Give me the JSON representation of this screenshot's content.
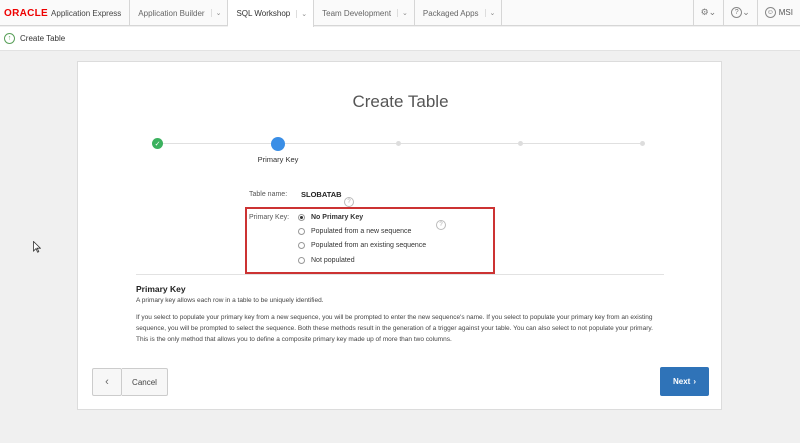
{
  "topnav": {
    "brand_oracle": "ORACLE",
    "brand_product": "Application Express",
    "tabs": [
      {
        "label": "Application Builder",
        "active": false
      },
      {
        "label": "SQL Workshop",
        "active": true
      },
      {
        "label": "Team Development",
        "active": false
      },
      {
        "label": "Packaged Apps",
        "active": false
      }
    ],
    "user": "MSI"
  },
  "breadcrumb": {
    "title": "Create Table"
  },
  "wizard": {
    "title": "Create Table",
    "current_step_label": "Primary Key",
    "table_name_label": "Table name:",
    "table_name_value": "SLOBATAB",
    "primary_key_label": "Primary Key:",
    "options": [
      {
        "label": "No Primary Key",
        "selected": true
      },
      {
        "label": "Populated from a new sequence",
        "selected": false
      },
      {
        "label": "Populated from an existing sequence",
        "selected": false
      },
      {
        "label": "Not populated",
        "selected": false
      }
    ]
  },
  "help": {
    "title": "Primary Key",
    "subtitle": "A primary key allows each row in a table to be uniquely identified.",
    "body": "If you select to populate your primary key from a new sequence, you will be prompted to enter the new sequence's name. If you select to populate your primary key from an existing sequence, you will be prompted to select the sequence. Both these methods result in the generation of a trigger against your table. You can also select to not populate your primary. This is the only method that allows you to define a composite primary key made up of more than two columns."
  },
  "buttons": {
    "cancel": "Cancel",
    "next": "Next"
  },
  "colors": {
    "accent": "#2f73b8",
    "step_done": "#3bb15e",
    "step_current": "#3a8ee6",
    "highlight_box": "#cc3333",
    "brand_red": "#ee0000"
  }
}
